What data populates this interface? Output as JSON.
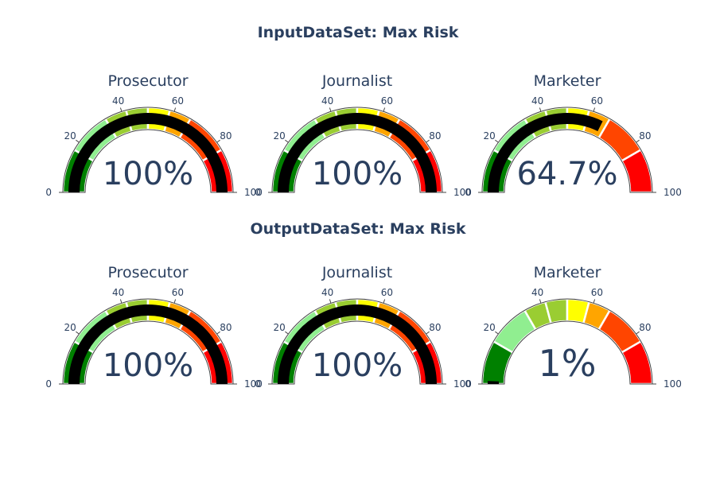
{
  "sections": {
    "input_title": "InputDataSet: Max Risk",
    "output_title": "OutputDataSet: Max Risk"
  },
  "chart_data": [
    {
      "type": "gauge",
      "group": "InputDataSet: Max Risk",
      "title": "Prosecutor",
      "value": 100,
      "value_label": "100%",
      "range": [
        0,
        100
      ],
      "ticks": [
        0,
        20,
        40,
        60,
        80,
        100
      ],
      "bands": [
        {
          "from": 0,
          "to": 16.7,
          "color": "#008000"
        },
        {
          "from": 16.7,
          "to": 33.3,
          "color": "#90ee90"
        },
        {
          "from": 33.3,
          "to": 41.7,
          "color": "#9acd32"
        },
        {
          "from": 41.7,
          "to": 50,
          "color": "#9acd32"
        },
        {
          "from": 50,
          "to": 58.3,
          "color": "#ffff00"
        },
        {
          "from": 58.3,
          "to": 66.7,
          "color": "#ffa500"
        },
        {
          "from": 66.7,
          "to": 83.3,
          "color": "#ff4500"
        },
        {
          "from": 83.3,
          "to": 100,
          "color": "#ff0000"
        }
      ]
    },
    {
      "type": "gauge",
      "group": "InputDataSet: Max Risk",
      "title": "Journalist",
      "value": 100,
      "value_label": "100%",
      "range": [
        0,
        100
      ],
      "ticks": [
        0,
        20,
        40,
        60,
        80,
        100
      ]
    },
    {
      "type": "gauge",
      "group": "InputDataSet: Max Risk",
      "title": "Marketer",
      "value": 64.7,
      "value_label": "64.7%",
      "range": [
        0,
        100
      ],
      "ticks": [
        0,
        20,
        40,
        60,
        80,
        100
      ]
    },
    {
      "type": "gauge",
      "group": "OutputDataSet: Max Risk",
      "title": "Prosecutor",
      "value": 100,
      "value_label": "100%",
      "range": [
        0,
        100
      ],
      "ticks": [
        0,
        20,
        40,
        60,
        80,
        100
      ]
    },
    {
      "type": "gauge",
      "group": "OutputDataSet: Max Risk",
      "title": "Journalist",
      "value": 100,
      "value_label": "100%",
      "range": [
        0,
        100
      ],
      "ticks": [
        0,
        20,
        40,
        60,
        80,
        100
      ]
    },
    {
      "type": "gauge",
      "group": "OutputDataSet: Max Risk",
      "title": "Marketer",
      "value": 1,
      "value_label": "1%",
      "range": [
        0,
        100
      ],
      "ticks": [
        0,
        20,
        40,
        60,
        80,
        100
      ]
    }
  ],
  "colors": {
    "band_green": "#008000",
    "band_lightgreen": "#90ee90",
    "band_yellowgreen": "#9acd32",
    "band_yellow": "#ffff00",
    "band_orange": "#ffa500",
    "band_orangered": "#ff4500",
    "band_red": "#ff0000",
    "bar": "#000000",
    "text": "#2a3f5f"
  }
}
